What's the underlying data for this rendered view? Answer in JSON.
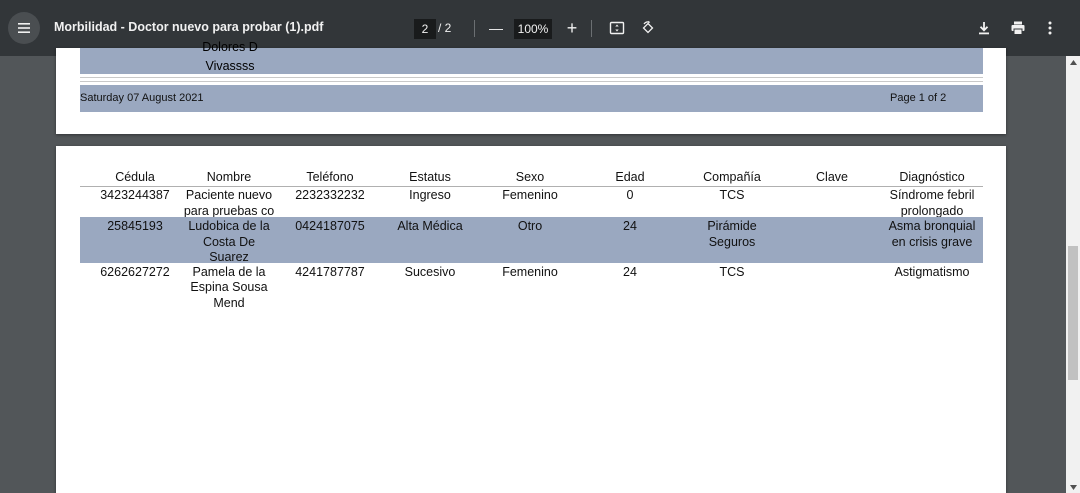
{
  "toolbar": {
    "title": "Morbilidad - Doctor nuevo para probar (1).pdf",
    "current_page": "2",
    "page_total": "/ 2",
    "zoom": "100%",
    "zoom_out_glyph": "—",
    "zoom_in_glyph": "+",
    "icons": [
      "menu-icon",
      "fit-page-icon",
      "rotate-icon",
      "download-icon",
      "print-icon",
      "more-vert-icon"
    ]
  },
  "page1": {
    "name_line1": "Dolores D",
    "name_line2": "Vivassss",
    "footer_date": "Saturday 07 August 2021",
    "footer_page": "Page 1 of 2"
  },
  "table": {
    "headers": [
      "Cédula",
      "Nombre",
      "Teléfono",
      "Estatus",
      "Sexo",
      "Edad",
      "Compañía",
      "Clave",
      "Diagnóstico"
    ],
    "rows": [
      {
        "cedula": "3423244387",
        "nombre1": "Paciente nuevo",
        "nombre2": "para pruebas co",
        "nombre3": "",
        "telefono": "2232332232",
        "estatus": "Ingreso",
        "sexo": "Femenino",
        "edad": "0",
        "compania1": "TCS",
        "compania2": "",
        "clave": "",
        "diag1": "Síndrome febril",
        "diag2": "prolongado"
      },
      {
        "cedula": "25845193",
        "nombre1": "Ludobica de la",
        "nombre2": "Costa De",
        "nombre3": "Suarez",
        "telefono": "0424187075",
        "estatus": "Alta Médica",
        "sexo": "Otro",
        "edad": "24",
        "compania1": "Pirámide",
        "compania2": "Seguros",
        "clave": "",
        "diag1": "Asma bronquial",
        "diag2": "en crisis grave"
      },
      {
        "cedula": "6262627272",
        "nombre1": "Pamela de la",
        "nombre2": "Espina Sousa",
        "nombre3": "Mend",
        "telefono": "4241787787",
        "estatus": "Sucesivo",
        "sexo": "Femenino",
        "edad": "24",
        "compania1": "TCS",
        "compania2": "",
        "clave": "",
        "diag1": "Astigmatismo",
        "diag2": ""
      }
    ]
  },
  "colors": {
    "toolbar_bg": "#323639",
    "viewer_bg": "#525659",
    "row_highlight": "#9aa8c0"
  }
}
